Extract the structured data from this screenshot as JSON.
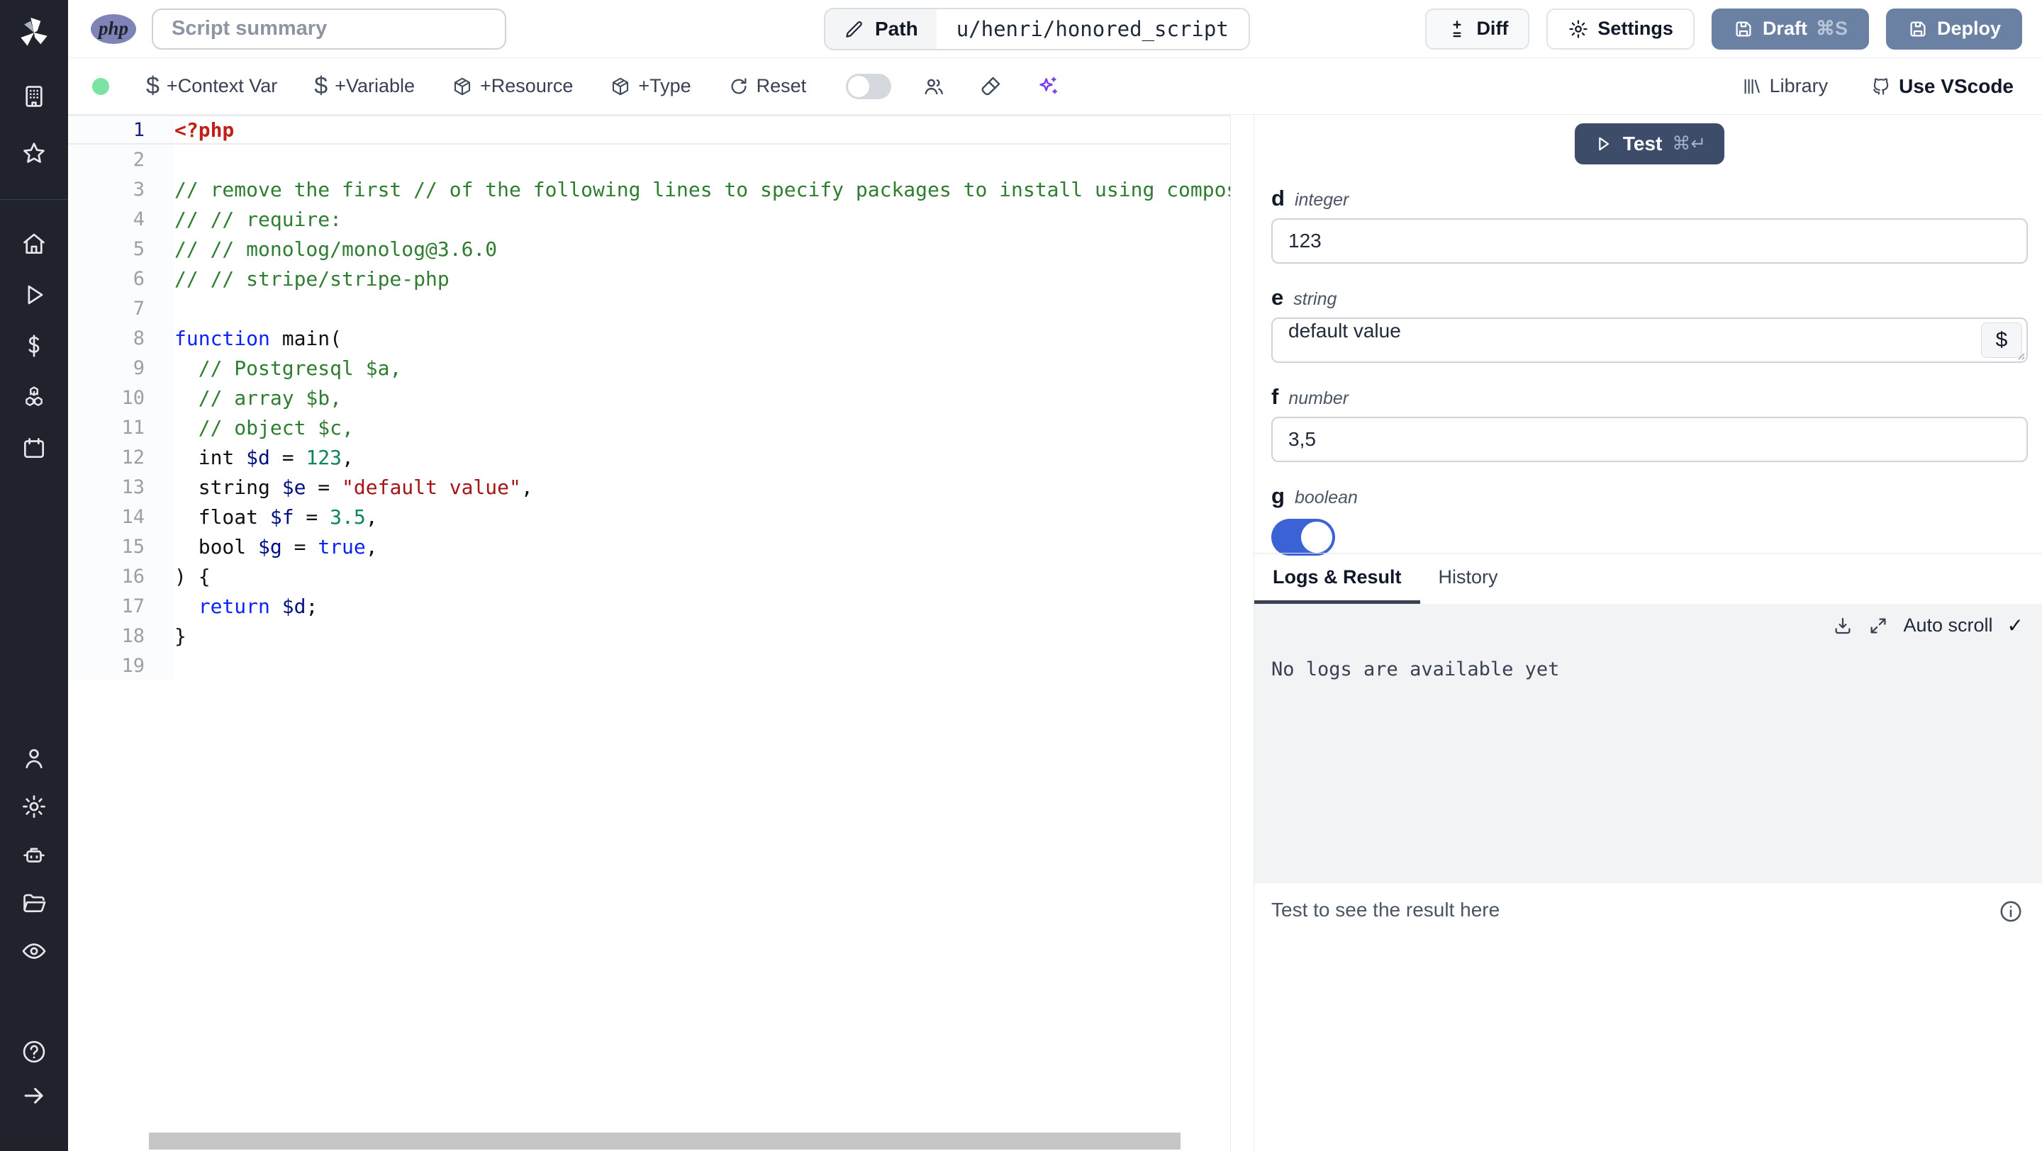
{
  "header": {
    "language_badge": "php",
    "summary_placeholder": "Script summary",
    "path_label": "Path",
    "path_value": "u/henri/honored_script",
    "diff_label": "Diff",
    "settings_label": "Settings",
    "draft_label": "Draft",
    "draft_shortcut": "⌘S",
    "deploy_label": "Deploy"
  },
  "toolbar": {
    "context_var_label": "+Context Var",
    "variable_label": "+Variable",
    "resource_label": "+Resource",
    "type_label": "+Type",
    "reset_label": "Reset",
    "library_label": "Library",
    "vscode_label": "Use VScode"
  },
  "icons": {
    "dollar": "$",
    "check": "✓"
  },
  "editor": {
    "active_line": 1,
    "lines": [
      {
        "n": 1,
        "tokens": [
          {
            "t": "<?php",
            "c": "tag"
          }
        ]
      },
      {
        "n": 2,
        "tokens": []
      },
      {
        "n": 3,
        "tokens": [
          {
            "t": "// remove the first // of the following lines to specify packages to install using composer",
            "c": "comment"
          }
        ]
      },
      {
        "n": 4,
        "tokens": [
          {
            "t": "// // require:",
            "c": "comment"
          }
        ]
      },
      {
        "n": 5,
        "tokens": [
          {
            "t": "// // monolog/monolog@3.6.0",
            "c": "comment"
          }
        ]
      },
      {
        "n": 6,
        "tokens": [
          {
            "t": "// // stripe/stripe-php",
            "c": "comment"
          }
        ]
      },
      {
        "n": 7,
        "tokens": []
      },
      {
        "n": 8,
        "tokens": [
          {
            "t": "function",
            "c": "kw"
          },
          {
            "t": " main(",
            "c": "plain"
          }
        ]
      },
      {
        "n": 9,
        "tokens": [
          {
            "t": "  ",
            "c": "plain"
          },
          {
            "t": "// Postgresql $a,",
            "c": "comment"
          }
        ]
      },
      {
        "n": 10,
        "tokens": [
          {
            "t": "  ",
            "c": "plain"
          },
          {
            "t": "// array $b,",
            "c": "comment"
          }
        ]
      },
      {
        "n": 11,
        "tokens": [
          {
            "t": "  ",
            "c": "plain"
          },
          {
            "t": "// object $c,",
            "c": "comment"
          }
        ]
      },
      {
        "n": 12,
        "tokens": [
          {
            "t": "  int ",
            "c": "plain"
          },
          {
            "t": "$d",
            "c": "var"
          },
          {
            "t": " = ",
            "c": "plain"
          },
          {
            "t": "123",
            "c": "num"
          },
          {
            "t": ",",
            "c": "plain"
          }
        ]
      },
      {
        "n": 13,
        "tokens": [
          {
            "t": "  string ",
            "c": "plain"
          },
          {
            "t": "$e",
            "c": "var"
          },
          {
            "t": " = ",
            "c": "plain"
          },
          {
            "t": "\"default value\"",
            "c": "str"
          },
          {
            "t": ",",
            "c": "plain"
          }
        ]
      },
      {
        "n": 14,
        "tokens": [
          {
            "t": "  float ",
            "c": "plain"
          },
          {
            "t": "$f",
            "c": "var"
          },
          {
            "t": " = ",
            "c": "plain"
          },
          {
            "t": "3.5",
            "c": "num"
          },
          {
            "t": ",",
            "c": "plain"
          }
        ]
      },
      {
        "n": 15,
        "tokens": [
          {
            "t": "  bool ",
            "c": "plain"
          },
          {
            "t": "$g",
            "c": "var"
          },
          {
            "t": " = ",
            "c": "plain"
          },
          {
            "t": "true",
            "c": "kw"
          },
          {
            "t": ",",
            "c": "plain"
          }
        ]
      },
      {
        "n": 16,
        "tokens": [
          {
            "t": ") {",
            "c": "plain"
          }
        ]
      },
      {
        "n": 17,
        "tokens": [
          {
            "t": "  ",
            "c": "plain"
          },
          {
            "t": "return",
            "c": "kw"
          },
          {
            "t": " ",
            "c": "plain"
          },
          {
            "t": "$d",
            "c": "var"
          },
          {
            "t": ";",
            "c": "plain"
          }
        ]
      },
      {
        "n": 18,
        "tokens": [
          {
            "t": "}",
            "c": "plain"
          }
        ]
      },
      {
        "n": 19,
        "tokens": []
      }
    ]
  },
  "panel": {
    "test_label": "Test",
    "test_shortcut": "⌘↵",
    "args": [
      {
        "name": "d",
        "type": "integer",
        "value": "123"
      },
      {
        "name": "e",
        "type": "string",
        "value": "default value"
      },
      {
        "name": "f",
        "type": "number",
        "value": "3,5"
      },
      {
        "name": "g",
        "type": "boolean",
        "value": "true"
      }
    ],
    "results": {
      "tab_logs": "Logs & Result",
      "tab_history": "History",
      "autoscroll_label": "Auto scroll",
      "empty_logs": "No logs are available yet",
      "result_placeholder": "Test to see the result here"
    }
  },
  "colors": {
    "draft_button": "#6b81a4",
    "test_button": "#3d4c68",
    "toggle_on": "#3b63d6",
    "status_dot": "#7de3a3",
    "ai_accent": "#7c3aed",
    "php_badge": "#7e84b5",
    "logs_bg": "#f1f3f5",
    "code_comment": "#2f7d31",
    "code_keyword": "#0b24f5",
    "code_variable": "#001080",
    "code_number": "#098658",
    "code_string": "#a31515",
    "code_tag": "#c02018"
  }
}
